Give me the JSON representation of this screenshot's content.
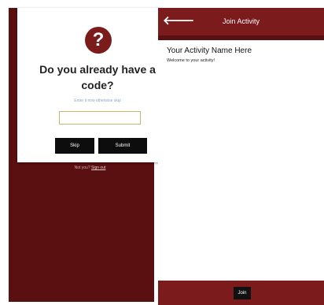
{
  "left": {
    "card": {
      "icon_glyph": "?",
      "title": "Do you already have a code?",
      "hint": "Enter it now otherwise skip",
      "input_value": "",
      "input_placeholder": "",
      "skip_label": "Skip",
      "submit_label": "Submit"
    },
    "footer": {
      "prefix": "Not you?",
      "link": "Sign out"
    }
  },
  "right": {
    "header": {
      "back_glyph": "🡐",
      "title": "Join Activity"
    },
    "activity": {
      "name": "Your Activity Name Here",
      "welcome": "Welcome to your activity!"
    },
    "join_label": "Join"
  },
  "colors": {
    "brand_dark": "#5a1010",
    "brand": "#7b1b1b",
    "button": "#0d0d0d"
  }
}
